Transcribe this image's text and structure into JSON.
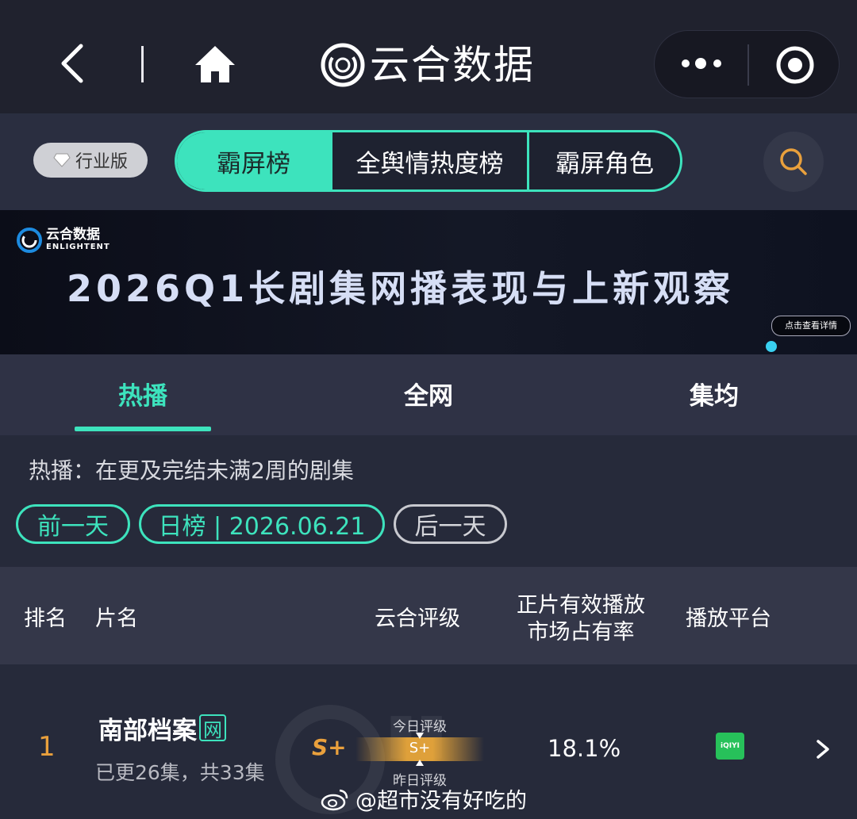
{
  "nav": {
    "brand": "云合数据"
  },
  "filters": {
    "industry_label": "行业版",
    "segments": [
      "霸屏榜",
      "全舆情热度榜",
      "霸屏角色"
    ],
    "active_segment": 0
  },
  "banner": {
    "brand": "云合数据",
    "brand_sub": "ENLIGHTENT",
    "title": "2026Q1长剧集网播表现与上新观察",
    "cta": "点击查看详情"
  },
  "tabs": {
    "items": [
      "热播",
      "全网",
      "集均"
    ],
    "active": 0
  },
  "info": {
    "description": "热播：在更及完结未满2周的剧集",
    "prev_day": "前一天",
    "date_label": "日榜 | 2026.06.21",
    "next_day": "后一天"
  },
  "table": {
    "headers": {
      "rank": "排名",
      "title": "片名",
      "grade": "云合评级",
      "share_line1": "正片有效播放",
      "share_line2": "市场占有率",
      "platform": "播放平台"
    },
    "rows": [
      {
        "rank": "1",
        "title": "南部档案",
        "badge": "网",
        "episodes": "已更26集，共33集",
        "grade": "S+",
        "today_grade_label": "今日评级",
        "today_grade": "S+",
        "yesterday_grade_label": "昨日评级",
        "share": "18.1%",
        "platform": "iQIYI"
      }
    ]
  },
  "watermark": "@超市没有好吃的",
  "colors": {
    "accent": "#3de3bd",
    "rank": "#e9a03c",
    "background": "#262a3a"
  }
}
